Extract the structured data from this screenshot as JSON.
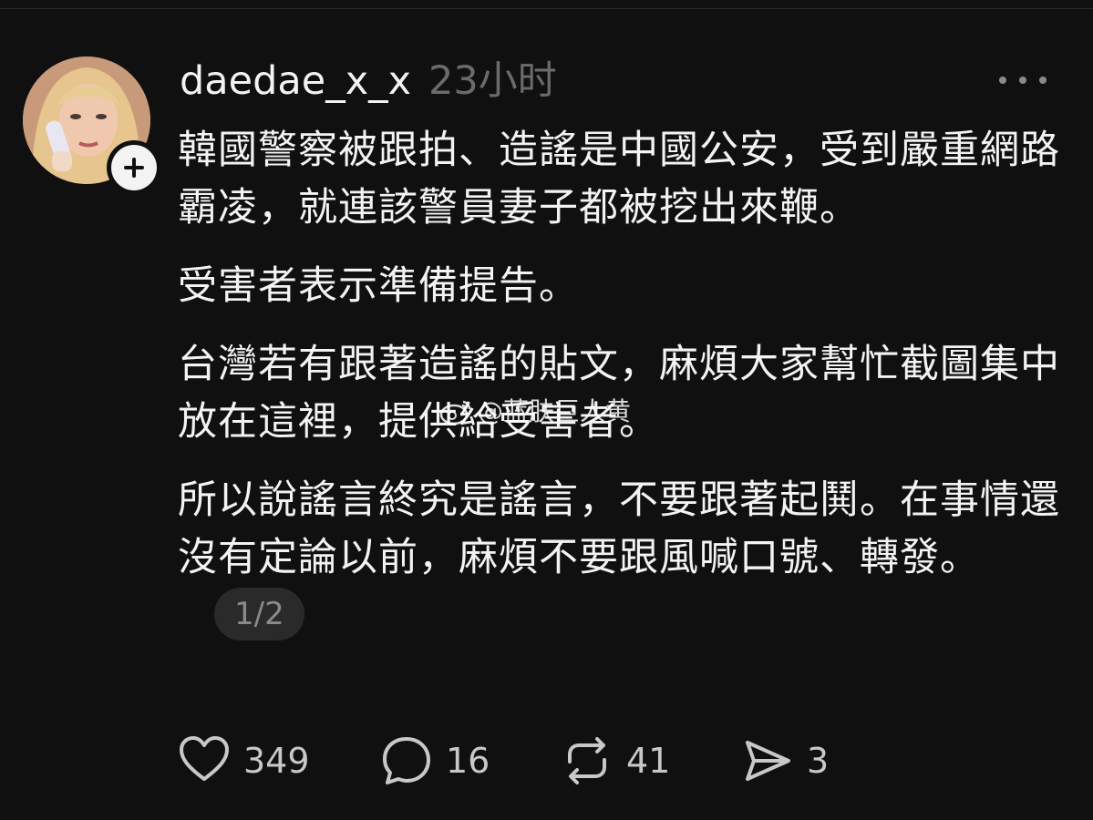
{
  "post": {
    "username": "daedae_x_x",
    "timestamp": "23小时",
    "paragraphs": [
      "韓國警察被跟拍、造謠是中國公安，受到嚴重網路霸凌，就連該警員妻子都被挖出來鞭。",
      "受害者表示準備提告。",
      "台灣若有跟著造謠的貼文，麻煩大家幫忙截圖集中放在這裡，提供給受害者。",
      "所以說謠言終究是謠言，不要跟著起鬨。在事情還沒有定論以前，麻煩不要跟風喊口號、轉發。"
    ],
    "page_indicator": "1/2",
    "watermark": "@蓝肤巨人黄"
  },
  "actions": {
    "likes": "349",
    "comments": "16",
    "reposts": "41",
    "shares": "3"
  },
  "icons": {
    "like": "heart-icon",
    "comment": "comment-bubble-icon",
    "repost": "repost-icon",
    "share": "send-icon",
    "more": "more-horizontal-icon",
    "follow": "plus-icon"
  },
  "colors": {
    "background": "#101010",
    "text": "#f3f3f3",
    "muted": "#6b6b6b",
    "pill": "#2a2a2a"
  }
}
